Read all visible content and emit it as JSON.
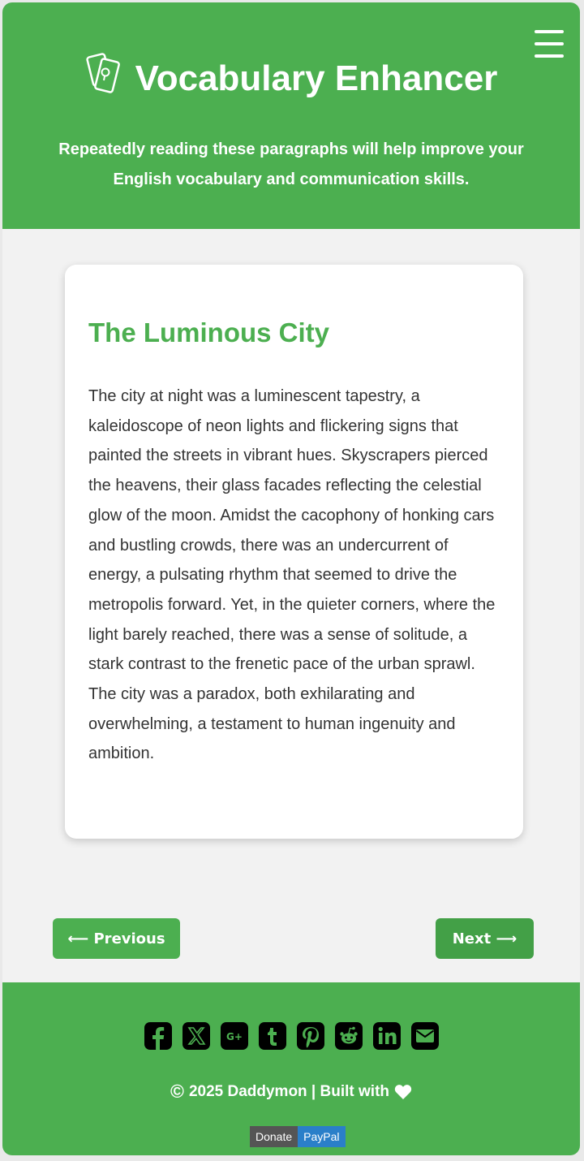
{
  "header": {
    "title": "Vocabulary Enhancer",
    "subtitle": "Repeatedly reading these paragraphs will help improve your English vocabulary and communication skills.",
    "menu_icon": "hamburger-menu-icon",
    "logo_icon": "flashcards-lightbulb-icon"
  },
  "card": {
    "title": "The Luminous City",
    "paragraph": "The city at night was a luminescent tapestry, a kaleidoscope of neon lights and flickering signs that painted the streets in vibrant hues. Skyscrapers pierced the heavens, their glass facades reflecting the celestial glow of the moon. Amidst the cacophony of honking cars and bustling crowds, there was an undercurrent of energy, a pulsating rhythm that seemed to drive the metropolis forward. Yet, in the quieter corners, where the light barely reached, there was a sense of solitude, a stark contrast to the frenetic pace of the urban sprawl. The city was a paradox, both exhilarating and overwhelming, a testament to human ingenuity and ambition."
  },
  "nav": {
    "prev_label": "⟵ Previous",
    "next_label": "Next ⟶"
  },
  "footer": {
    "social": [
      "facebook-icon",
      "x-twitter-icon",
      "google-plus-icon",
      "tumblr-icon",
      "pinterest-icon",
      "reddit-icon",
      "linkedin-icon",
      "email-icon"
    ],
    "copyright_symbol": "©",
    "copyright": "2025 Daddymon | Built with",
    "donate_left": "Donate",
    "donate_right": "PayPal"
  },
  "colors": {
    "brand_green": "#4caf50",
    "background": "#f2f2f2",
    "text": "#333333",
    "paypal_blue": "#2a7fc9"
  }
}
